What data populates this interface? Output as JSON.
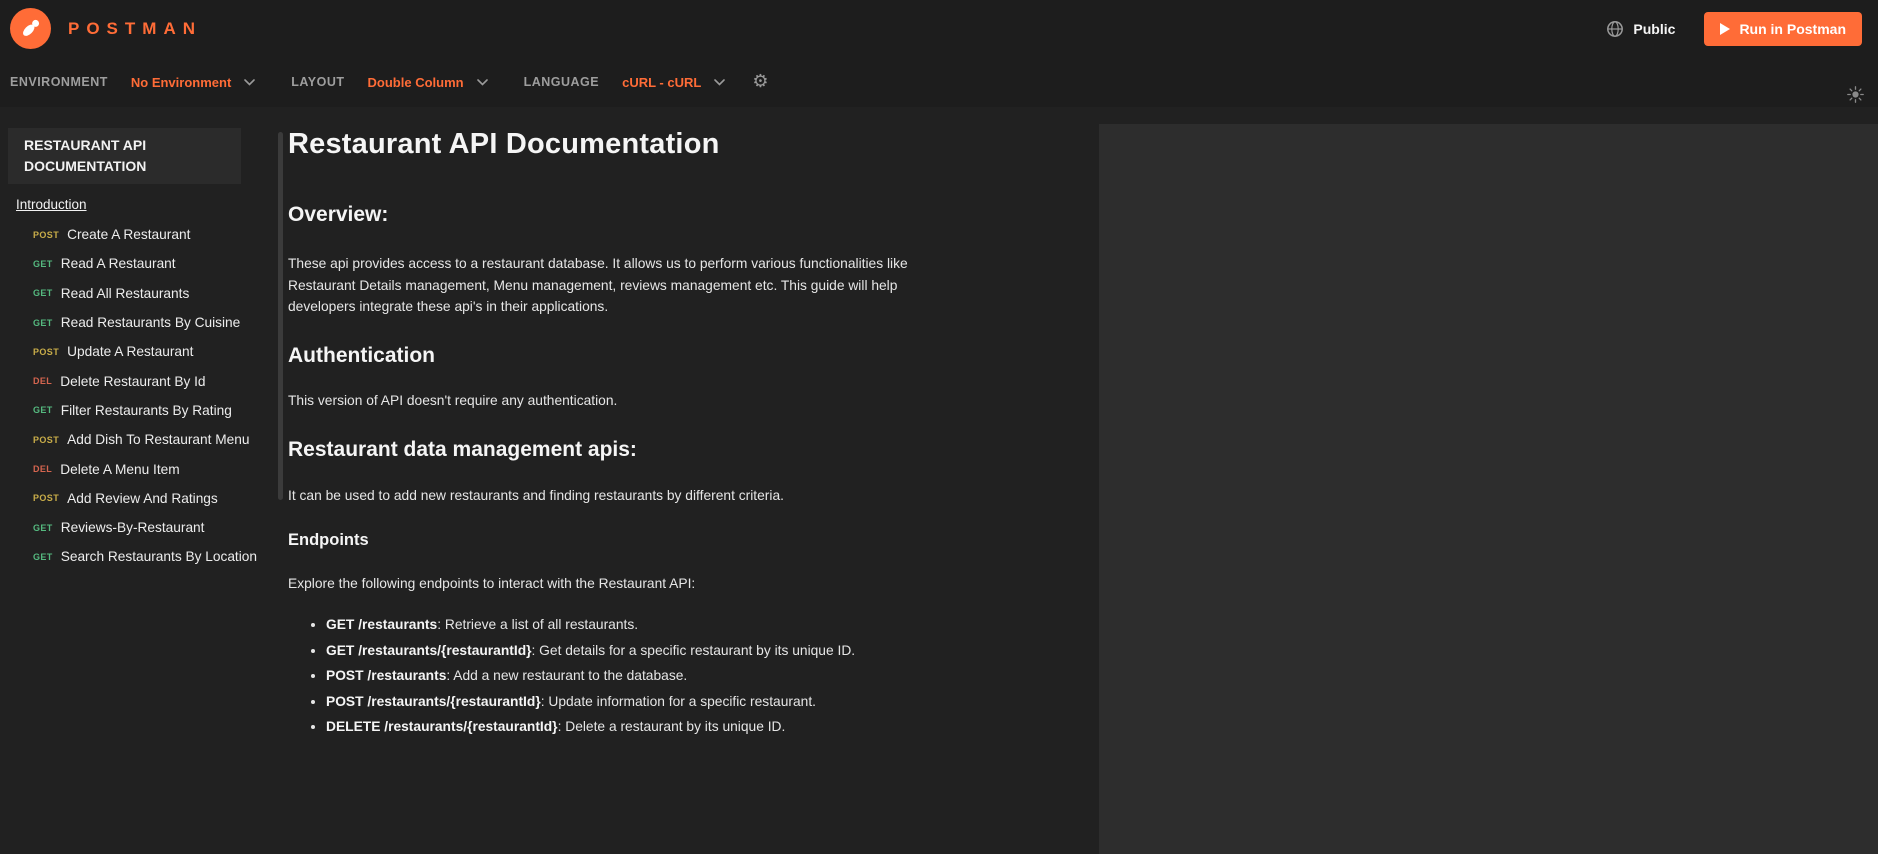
{
  "header": {
    "brand": "POSTMAN",
    "visibility_label": "Public",
    "run_button_label": "Run in Postman"
  },
  "toolbar": {
    "environment": {
      "label": "ENVIRONMENT",
      "value": "No Environment"
    },
    "layout": {
      "label": "LAYOUT",
      "value": "Double Column"
    },
    "language": {
      "label": "LANGUAGE",
      "value": "cURL - cURL"
    }
  },
  "sidebar": {
    "collection_title": "RESTAURANT API DOCUMENTATION",
    "intro_link": "Introduction",
    "items": [
      {
        "method": "POST",
        "label": "Create A Restaurant"
      },
      {
        "method": "GET",
        "label": "Read A Restaurant"
      },
      {
        "method": "GET",
        "label": "Read All Restaurants"
      },
      {
        "method": "GET",
        "label": "Read Restaurants By Cuisine"
      },
      {
        "method": "POST",
        "label": "Update A Restaurant"
      },
      {
        "method": "DEL",
        "label": "Delete Restaurant By Id"
      },
      {
        "method": "GET",
        "label": "Filter Restaurants By Rating"
      },
      {
        "method": "POST",
        "label": "Add Dish To Restaurant Menu"
      },
      {
        "method": "DEL",
        "label": "Delete A Menu Item"
      },
      {
        "method": "POST",
        "label": "Add Review And Ratings"
      },
      {
        "method": "GET",
        "label": "Reviews-By-Restaurant"
      },
      {
        "method": "GET",
        "label": "Search Restaurants By Location"
      }
    ]
  },
  "content": {
    "title": "Restaurant API Documentation",
    "overview_heading": "Overview:",
    "overview_text": "These api provides access to a restaurant database. It allows us to perform various functionalities like Restaurant Details management, Menu management, reviews management etc. This guide will help developers integrate these api's in their applications.",
    "auth_heading": "Authentication",
    "auth_text": "This version of API doesn't require any authentication.",
    "mgmt_heading": "Restaurant data management apis:",
    "mgmt_text": "It can be used to add new restaurants and finding restaurants by different criteria.",
    "endpoints_heading": "Endpoints",
    "endpoints_text": "Explore the following endpoints to interact with the Restaurant API:",
    "endpoints_list": [
      {
        "lead": "GET /restaurants",
        "rest": ": Retrieve a list of all restaurants."
      },
      {
        "lead": "GET /restaurants/{restaurantId}",
        "rest": ": Get details for a specific restaurant by its unique ID."
      },
      {
        "lead": "POST /restaurants",
        "rest": ": Add a new restaurant to the database."
      },
      {
        "lead": "POST /restaurants/{restaurantId}",
        "rest": ": Update information for a specific restaurant."
      },
      {
        "lead": "DELETE /restaurants/{restaurantId}",
        "rest": ": Delete a restaurant by its unique ID."
      }
    ]
  },
  "icons": {
    "logo": "postman-astronaut",
    "globe": "globe",
    "play": "play-triangle",
    "chevron": "chevron-down",
    "gear": "⚙",
    "theme_toggle": "sun"
  },
  "colors": {
    "accent_orange": "#FF6C37",
    "header_bg": "#1D1D1D",
    "page_bg": "#212121",
    "code_panel_bg": "#2D2D2D",
    "method_get": "#55B97F",
    "method_post": "#C9AD49",
    "method_del": "#D5654F"
  }
}
